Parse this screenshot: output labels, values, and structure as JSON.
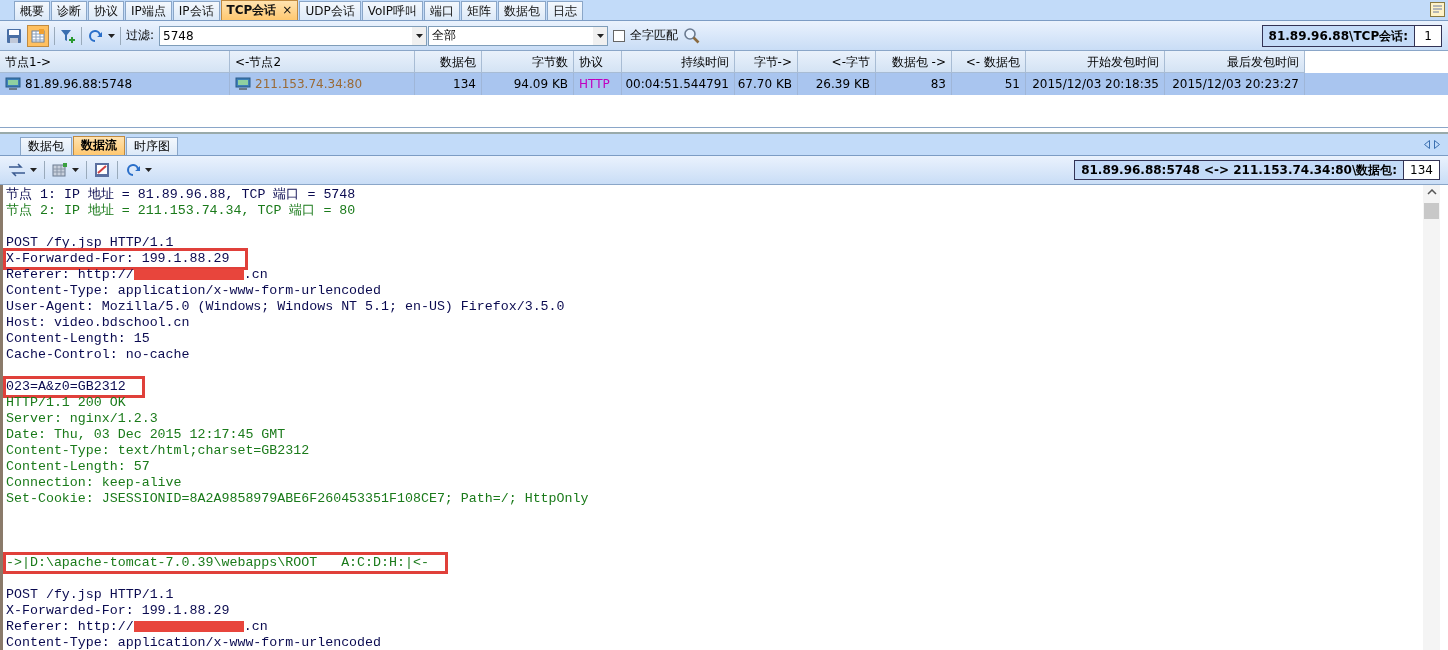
{
  "main_tabs": [
    {
      "label": "概要",
      "selected": false
    },
    {
      "label": "诊断",
      "selected": false
    },
    {
      "label": "协议",
      "selected": false
    },
    {
      "label": "IP端点",
      "selected": false
    },
    {
      "label": "IP会话",
      "selected": false
    },
    {
      "label": "TCP会话",
      "selected": true,
      "close": "×"
    },
    {
      "label": "UDP会话",
      "selected": false
    },
    {
      "label": "VoIP呼叫",
      "selected": false
    },
    {
      "label": "端口",
      "selected": false
    },
    {
      "label": "矩阵",
      "selected": false
    },
    {
      "label": "数据包",
      "selected": false
    },
    {
      "label": "日志",
      "selected": false
    }
  ],
  "toolbar": {
    "filter_label": "过滤:",
    "filter_value": "5748",
    "scope_value": "全部",
    "whole_word": {
      "label": "全字匹配",
      "checked": false
    },
    "pressed_button": true,
    "context_label": "81.89.96.88\\TCP会话:",
    "context_count": "1"
  },
  "table": {
    "columns": [
      "节点1->",
      "<-节点2",
      "数据包",
      "字节数",
      "协议",
      "持续时间",
      "字节->",
      "<-字节",
      "数据包 ->",
      "<- 数据包",
      "开始发包时间",
      "最后发包时间"
    ],
    "rows": [
      {
        "selected": true,
        "cells": [
          "81.89.96.88:5748",
          "211.153.74.34:80",
          "134",
          "94.09 KB",
          "HTTP",
          "00:04:51.544791",
          "67.70 KB",
          "26.39 KB",
          "83",
          "51",
          "2015/12/03 20:18:35",
          "2015/12/03 20:23:27"
        ]
      }
    ]
  },
  "detail_tabs": [
    {
      "label": "数据包",
      "selected": false
    },
    {
      "label": "数据流",
      "selected": true
    },
    {
      "label": "时序图",
      "selected": false
    }
  ],
  "stream_toolbar": {
    "context_label": "81.89.96.88:5748 <-> 211.153.74.34:80\\数据包:",
    "context_count": "134"
  },
  "stream": [
    {
      "kind": "client",
      "text": "节点 1: IP 地址 = 81.89.96.88, TCP 端口 = 5748"
    },
    {
      "kind": "server",
      "text": "节点 2: IP 地址 = 211.153.74.34, TCP 端口 = 80"
    },
    {
      "kind": "blank"
    },
    {
      "kind": "client",
      "text": "POST /fy.jsp HTTP/1.1"
    },
    {
      "kind": "client",
      "text": "X-Forwarded-For: 199.1.88.29",
      "highlighted": true
    },
    {
      "kind": "client",
      "text": "Referer: http://",
      "redacted": true,
      "text_after": ".cn"
    },
    {
      "kind": "client",
      "text": "Content-Type: application/x-www-form-urlencoded"
    },
    {
      "kind": "client",
      "text": "User-Agent: Mozilla/5.0 (Windows; Windows NT 5.1; en-US) Firefox/3.5.0"
    },
    {
      "kind": "client",
      "text": "Host: video.bdschool.cn"
    },
    {
      "kind": "client",
      "text": "Content-Length: 15"
    },
    {
      "kind": "client",
      "text": "Cache-Control: no-cache"
    },
    {
      "kind": "blank"
    },
    {
      "kind": "client",
      "text": "023=A&z0=GB2312",
      "highlighted": true
    },
    {
      "kind": "server",
      "text": "HTTP/1.1 200 OK"
    },
    {
      "kind": "server",
      "text": "Server: nginx/1.2.3"
    },
    {
      "kind": "server",
      "text": "Date: Thu, 03 Dec 2015 12:17:45 GMT"
    },
    {
      "kind": "server",
      "text": "Content-Type: text/html;charset=GB2312"
    },
    {
      "kind": "server",
      "text": "Content-Length: 57"
    },
    {
      "kind": "server",
      "text": "Connection: keep-alive"
    },
    {
      "kind": "server",
      "text": "Set-Cookie: JSESSIONID=8A2A9858979ABE6F260453351F108CE7; Path=/; HttpOnly"
    },
    {
      "kind": "blank"
    },
    {
      "kind": "blank"
    },
    {
      "kind": "blank"
    },
    {
      "kind": "server",
      "text": "->|D:\\apache-tomcat-7.0.39\\webapps\\ROOT   A:C:D:H:|<-",
      "highlighted": true
    },
    {
      "kind": "blank"
    },
    {
      "kind": "client",
      "text": "POST /fy.jsp HTTP/1.1"
    },
    {
      "kind": "client",
      "text": "X-Forwarded-For: 199.1.88.29"
    },
    {
      "kind": "client",
      "text": "Referer: http://",
      "redacted": true,
      "text_after": ".cn"
    },
    {
      "kind": "client",
      "text": "Content-Type: application/x-www-form-urlencoded"
    }
  ]
}
